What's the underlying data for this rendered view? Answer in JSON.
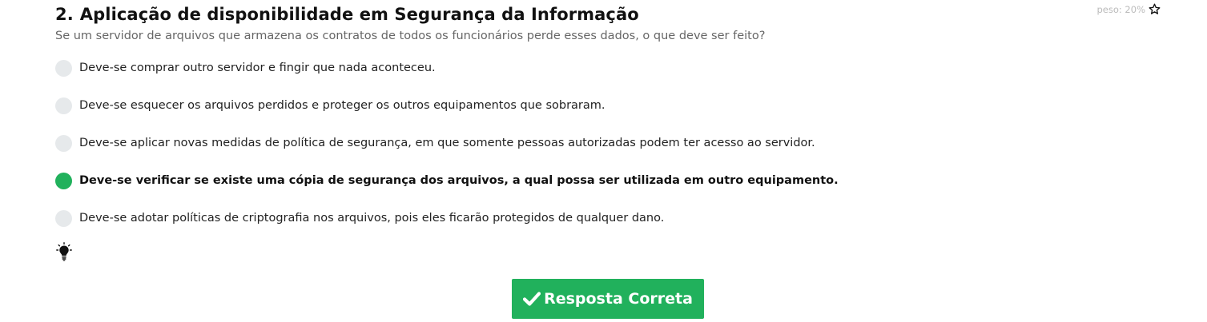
{
  "question": {
    "number": "2.",
    "title": "Aplicação de disponibilidade em Segurança da Informação",
    "subtitle": "Se um servidor de arquivos que armazena os contratos de todos os funcionários perde esses dados, o que deve ser feito?",
    "weight_label": "peso: 20%",
    "weight_icon": "star-outline-icon",
    "options": [
      {
        "label": "Deve-se comprar outro servidor e fingir que nada aconteceu.",
        "selected": false
      },
      {
        "label": "Deve-se esquecer os arquivos perdidos e proteger os outros equipamentos que sobraram.",
        "selected": false
      },
      {
        "label": "Deve-se aplicar novas medidas de política de segurança, em que somente pessoas autorizadas podem ter acesso ao servidor.",
        "selected": false
      },
      {
        "label": "Deve-se verificar se existe uma cópia de segurança dos arquivos, a qual possa ser utilizada em outro equipamento.",
        "selected": true
      },
      {
        "label": "Deve-se adotar políticas de criptografia nos arquivos, pois eles ficarão protegidos de qualquer dano.",
        "selected": false
      }
    ],
    "hint_icon": "lightbulb-icon"
  },
  "answer_button": {
    "label": "Resposta Correta",
    "icon": "checkmark-icon"
  },
  "colors": {
    "accent": "#21b15c",
    "radio_unselected": "#e6e9eb",
    "subtitle_text": "#666666",
    "weight_text": "#bbbbbb"
  }
}
